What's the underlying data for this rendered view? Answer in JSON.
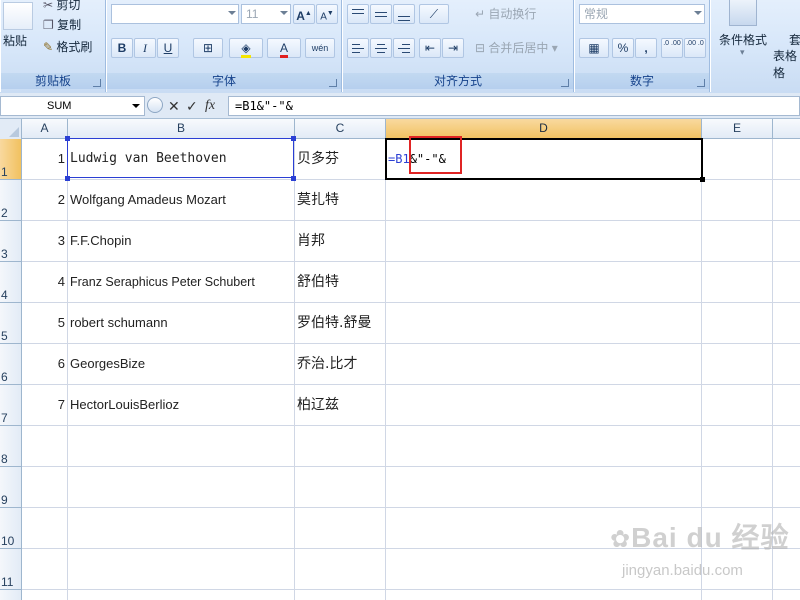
{
  "ribbon": {
    "clipboard": {
      "cut": "剪切",
      "copy": "复制",
      "format_painter": "格式刷",
      "paste": "粘贴",
      "label": "剪贴板"
    },
    "font": {
      "font_name": "",
      "font_size": "11",
      "grow": "A",
      "shrink": "A",
      "bold": "B",
      "italic": "I",
      "underline": "U",
      "font_color": "A",
      "phonetic": "wén",
      "label": "字体"
    },
    "alignment": {
      "wrap_text": "自动换行",
      "merge_center": "合并后居中",
      "label": "对齐方式"
    },
    "number": {
      "format": "常规",
      "percent": "%",
      "comma": ",",
      "inc_decimal": ".0 .00",
      "dec_decimal": ".00 .0",
      "label": "数字"
    },
    "styles": {
      "conditional_format": "条件格式",
      "table_format_partial": "套",
      "table_format_partial2": "表格格"
    }
  },
  "formula_bar": {
    "name_box": "SUM",
    "formula": "=B1&\"-\"&"
  },
  "columns": [
    "A",
    "B",
    "C",
    "D",
    "E"
  ],
  "active_column": "D",
  "rows": [
    {
      "num": "1",
      "a": "1",
      "b": "Ludwig van Beethoven",
      "c": "贝多芬"
    },
    {
      "num": "2",
      "a": "2",
      "b": "Wolfgang Amadeus Mozart",
      "c": "莫扎特"
    },
    {
      "num": "3",
      "a": "3",
      "b": "F.F.Chopin",
      "c": "肖邦"
    },
    {
      "num": "4",
      "a": "4",
      "b": "Franz Seraphicus Peter Schubert",
      "c": "舒伯特"
    },
    {
      "num": "5",
      "a": "5",
      "b": "robert schumann",
      "c": "罗伯特.舒曼"
    },
    {
      "num": "6",
      "a": "6",
      "b": "GeorgesBize",
      "c": "乔治.比才"
    },
    {
      "num": "7",
      "a": "7",
      "b": "HectorLouisBerlioz",
      "c": "柏辽兹"
    },
    {
      "num": "8",
      "a": "",
      "b": "",
      "c": ""
    },
    {
      "num": "9",
      "a": "",
      "b": "",
      "c": ""
    },
    {
      "num": "10",
      "a": "",
      "b": "",
      "c": ""
    },
    {
      "num": "11",
      "a": "",
      "b": "",
      "c": ""
    }
  ],
  "edit_cell": {
    "ref_part": "=B1",
    "rest": "&\"-\"&"
  },
  "watermark": {
    "brand": "Bai du 经验",
    "url": "jingyan.baidu.com"
  },
  "colors": {
    "ref_blue": "#2b3fd4",
    "highlight_red": "#e02424",
    "active_header": "#f1c15f"
  }
}
